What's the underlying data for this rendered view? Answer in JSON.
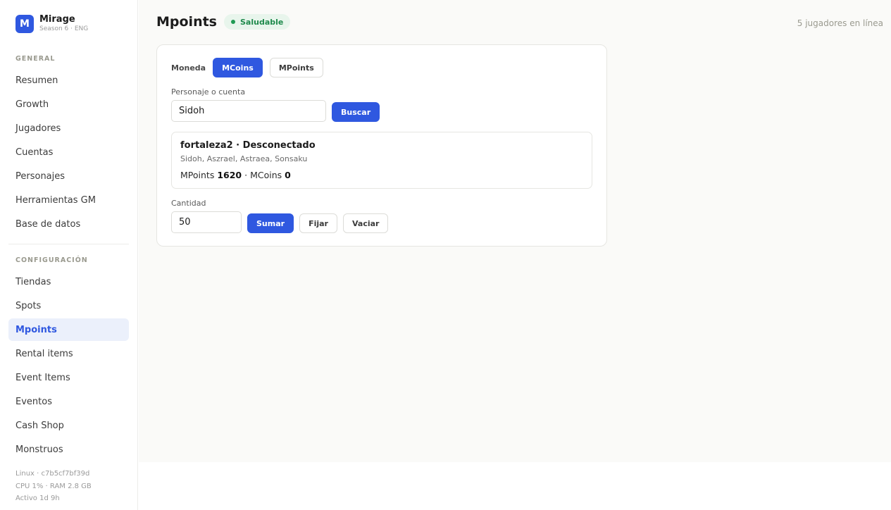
{
  "brand": {
    "letter": "M",
    "name": "Mirage",
    "subtitle": "Season 6 · ENG"
  },
  "sidebar": {
    "general_label": "GENERAL",
    "general_items": [
      {
        "label": "Resumen"
      },
      {
        "label": "Growth"
      },
      {
        "label": "Jugadores"
      },
      {
        "label": "Cuentas"
      },
      {
        "label": "Personajes"
      },
      {
        "label": "Herramientas GM"
      },
      {
        "label": "Base de datos"
      }
    ],
    "config_label": "CONFIGURACIÓN",
    "config_items": [
      {
        "label": "Tiendas"
      },
      {
        "label": "Spots"
      },
      {
        "label": "Mpoints",
        "active": true
      },
      {
        "label": "Rental items"
      },
      {
        "label": "Event Items"
      },
      {
        "label": "Eventos"
      },
      {
        "label": "Cash Shop"
      },
      {
        "label": "Monstruos"
      }
    ],
    "system": {
      "host": "Linux · c7b5cf7bf39d",
      "usage": "CPU 1% · RAM 2.8 GB",
      "uptime": "Activo 1d 9h"
    }
  },
  "header": {
    "title": "Mpoints",
    "status": "Saludable",
    "online": "5 jugadores en línea"
  },
  "form": {
    "currency_label": "Moneda",
    "currency_options": [
      "MCoins",
      "MPoints"
    ],
    "currency_selected": "MCoins",
    "search_label": "Personaje o cuenta",
    "search_value": "Sidoh",
    "search_button": "Buscar",
    "result": {
      "account": "fortaleza2",
      "separator": " · ",
      "status": "Desconectado",
      "characters": "Sidoh, Aszrael, Astraea, Sonsaku",
      "mpoints_label": "MPoints",
      "mpoints_value": "1620",
      "mcoins_label": "MCoins",
      "mcoins_value": "0"
    },
    "amount_label": "Cantidad",
    "amount_value": "50",
    "add_button": "Sumar",
    "set_button": "Fijar",
    "clear_button": "Vaciar"
  },
  "colors": {
    "accent": "#2f58e0",
    "healthy": "#1f8a4c",
    "active_bg": "#ebf0fb"
  }
}
